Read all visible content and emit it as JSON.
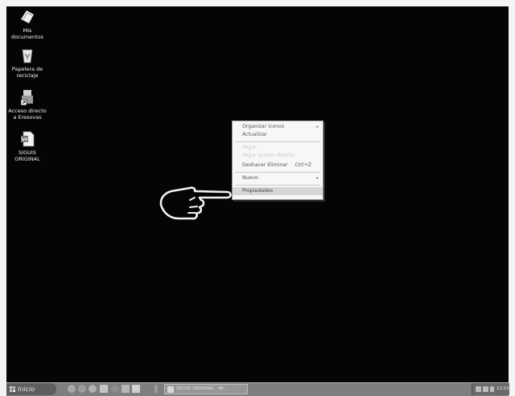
{
  "desktop": {
    "icons": [
      {
        "label_1": "Mis",
        "label_2": "documentos",
        "icon": "my-documents-icon"
      },
      {
        "label_1": "Papelera de",
        "label_2": "reciclaje",
        "icon": "recycle-bin-icon"
      },
      {
        "label_1": "Acceso directo",
        "label_2": "a Eresovas",
        "icon": "shortcut-icon"
      },
      {
        "label_1": "SIGUIS",
        "label_2": "ORIGINAL",
        "icon": "word-document-icon"
      }
    ]
  },
  "context_menu": {
    "items": [
      {
        "label": "Organizar iconos",
        "has_submenu": true
      },
      {
        "label": "Actualizar"
      },
      {
        "label": "Pegar",
        "disabled": true
      },
      {
        "label": "Pegar acceso directo",
        "disabled": true
      },
      {
        "label": "Deshacer Eliminar",
        "shortcut": "Ctrl+Z"
      },
      {
        "label": "Nuevo",
        "has_submenu": true
      },
      {
        "label": "Propiedades",
        "selected": true
      }
    ],
    "submenu_arrow": "▸"
  },
  "pointer": {
    "icon": "pointing-hand-icon"
  },
  "taskbar": {
    "start_label": "Inicio",
    "task_label": "SIGUIS ORIGINAL - Mi...",
    "clock": "12:55"
  },
  "colors": {
    "desktop": "#050505",
    "taskbar": "#7e7e7e",
    "menu": "#f7f7f7"
  }
}
